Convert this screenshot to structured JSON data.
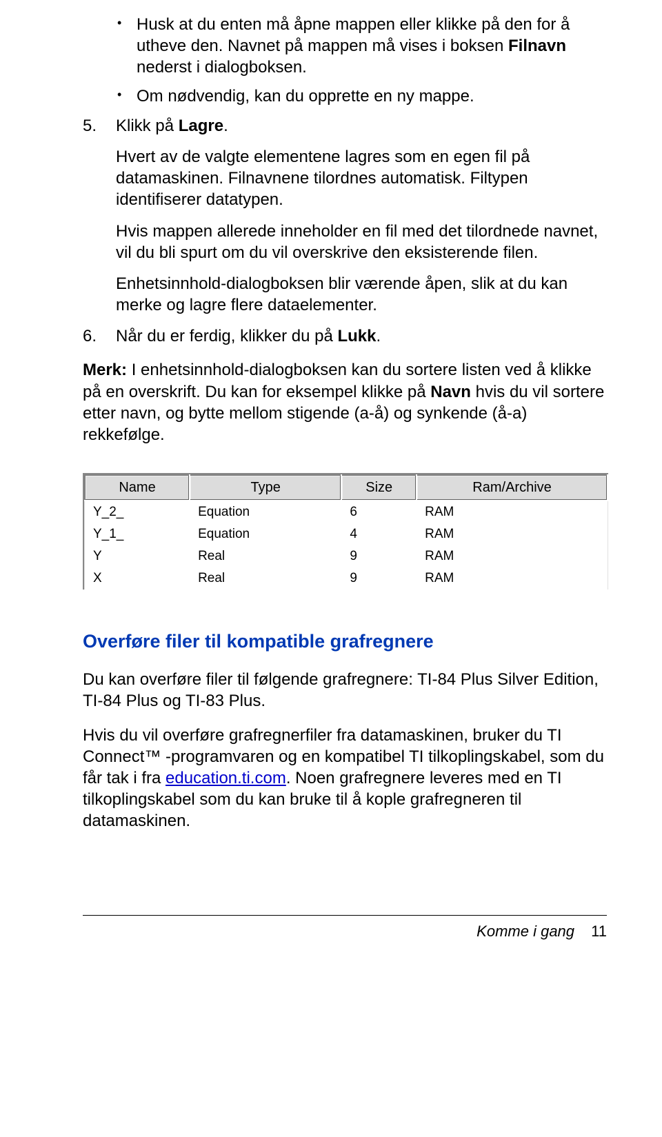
{
  "bullets": {
    "b1_pre": "Husk at du enten må åpne mappen eller klikke på den for å utheve den. Navnet på mappen må vises i boksen ",
    "b1_bold": "Filnavn",
    "b1_post": " nederst i dialogboksen.",
    "b2": "Om nødvendig, kan du opprette en ny mappe."
  },
  "step5": {
    "marker": "5.",
    "line_pre": "Klikk på ",
    "line_bold": "Lagre",
    "line_post": ".",
    "p1": "Hvert av de valgte elementene lagres som en egen fil på datamaskinen. Filnavnene tilordnes automatisk. Filtypen identifiserer datatypen.",
    "p2": "Hvis mappen allerede inneholder en fil med det tilordnede navnet, vil du bli spurt om du vil overskrive den eksisterende filen.",
    "p3": "Enhetsinnhold-dialogboksen blir værende åpen, slik at du kan merke og lagre flere dataelementer."
  },
  "step6": {
    "marker": "6.",
    "line_pre": "Når du er ferdig, klikker du på ",
    "line_bold": "Lukk",
    "line_post": "."
  },
  "merk": {
    "bold": "Merk:",
    "t1": " I enhetsinnhold-dialogboksen kan du sortere listen ved å klikke på en overskrift. Du kan for eksempel klikke på ",
    "bold2": "Navn",
    "t2": " hvis du vil sortere etter navn, og bytte mellom stigende (a-å) og synkende (å-a) rekkefølge."
  },
  "table": {
    "headers": [
      "Name",
      "Type",
      "Size",
      "Ram/Archive"
    ],
    "rows": [
      [
        "Y_2_",
        "Equation",
        "6",
        "RAM"
      ],
      [
        "Y_1_",
        "Equation",
        "4",
        "RAM"
      ],
      [
        "Y",
        "Real",
        "9",
        "RAM"
      ],
      [
        "X",
        "Real",
        "9",
        "RAM"
      ]
    ]
  },
  "heading": "Overføre filer til kompatible grafregnere",
  "section": {
    "p1": "Du kan overføre filer til følgende grafregnere: TI-84 Plus Silver Edition, TI-84 Plus  og TI-83 Plus.",
    "p2_a": "Hvis du vil overføre grafregnerfiler fra datamaskinen, bruker du TI Connect™ -programvaren og en kompatibel TI tilkoplingskabel, som du får tak i fra ",
    "p2_link": "education.ti.com",
    "p2_b": ". Noen grafregnere leveres med en TI tilkoplingskabel som du kan bruke til å kople grafregneren til datamaskinen."
  },
  "footer": {
    "title": "Komme i gang",
    "page": "11"
  }
}
